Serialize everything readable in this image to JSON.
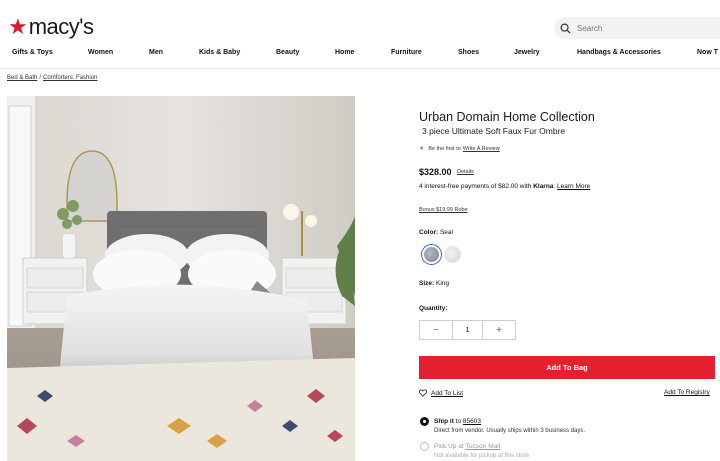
{
  "brand": {
    "logo_text": "macy's",
    "star_color": "#e11a2b"
  },
  "search": {
    "placeholder": "Search",
    "icon": "search-icon"
  },
  "nav": {
    "items": [
      "Gifts & Toys",
      "Women",
      "Men",
      "Kids & Baby",
      "Beauty",
      "Home",
      "Furniture",
      "Shoes",
      "Jewelry",
      "Handbags & Accessories",
      "Now T"
    ]
  },
  "breadcrumb": {
    "items": [
      "Bed & Bath",
      "Comforters: Fashion"
    ],
    "separator": "/"
  },
  "product": {
    "brand_title": "Urban Domain Home Collection",
    "name": "3 piece Ultimate Soft Faux Fur Ombre",
    "review_prefix": "Be the first to",
    "review_link": "Write A Review",
    "price": "$328.00",
    "details_link": "Details",
    "installments_text": "4 interest-free payments of $82.00 with",
    "installments_brand": "Klarna",
    "installments_link": "Learn More",
    "bonus_link": "Bonus $19.99 Robe",
    "color_label": "Color:",
    "color_value": "Seal",
    "size_label": "Size:",
    "size_value": "King",
    "quantity_label": "Quantity:",
    "quantity_value": "1",
    "minus": "−",
    "plus": "+",
    "add_to_bag": "Add To Bag",
    "add_to_bag_color": "#e4202e",
    "add_to_list": "Add To List",
    "add_to_registry": "Add To Registry",
    "ship_label": "Ship it",
    "ship_to": "to",
    "zip": "85603",
    "ship_note": "Direct from vendor. Usually ships within 3 business days.",
    "pickup_label": "Pick Up at",
    "pickup_store": "Tucson Mall",
    "pickup_note": "Not available for pickup at this store"
  }
}
